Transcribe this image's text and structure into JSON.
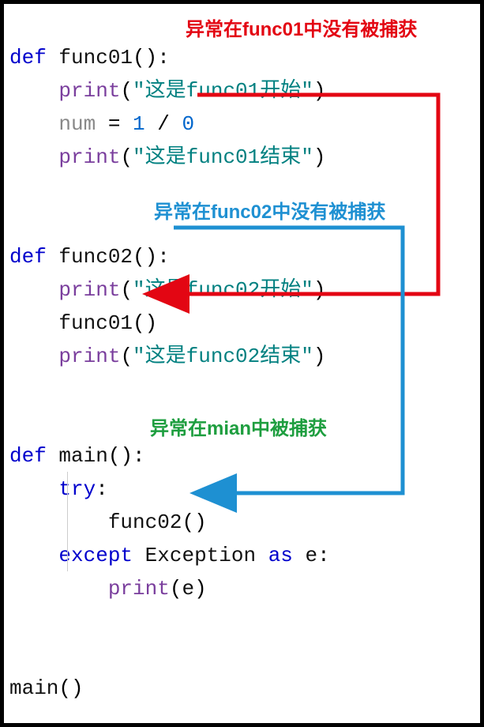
{
  "code": {
    "line1_def": "def",
    "line1_name": "func01",
    "line1_rest": "():",
    "line2_print": "print",
    "line2_str": "\"这是func01开始\"",
    "line3_var": "num",
    "line3_eq": " = ",
    "line3_n1": "1",
    "line3_slash": " / ",
    "line3_n0": "0",
    "line4_print": "print",
    "line4_str": "\"这是func01结束\"",
    "line7_def": "def",
    "line7_name": "func02",
    "line7_rest": "():",
    "line8_print": "print",
    "line8_str": "\"这是func02开始\"",
    "line9_call": "func01",
    "line10_print": "print",
    "line10_str": "\"这是func02结束\"",
    "line13_def": "def",
    "line13_name": "main",
    "line13_rest": "():",
    "line14_try": "try",
    "line15_call": "func02",
    "line16_except": "except",
    "line16_exc": "Exception",
    "line16_as": "as",
    "line16_e": "e",
    "line17_print": "print",
    "line17_arg": "e",
    "line20_call": "main",
    "lparen": "(",
    "rparen": ")",
    "colon": ":"
  },
  "annotations": {
    "red": "异常在func01中没有被捕获",
    "blue": "异常在func02中没有被捕获",
    "green": "异常在mian中被捕获"
  },
  "colors": {
    "keyword": "#0000CC",
    "string": "#008080",
    "number": "#0066CC",
    "builtin": "#7A3E9D",
    "variable": "#888888",
    "ann_red": "#E30613",
    "ann_blue": "#1E90D2",
    "ann_green": "#1E9E3F"
  }
}
